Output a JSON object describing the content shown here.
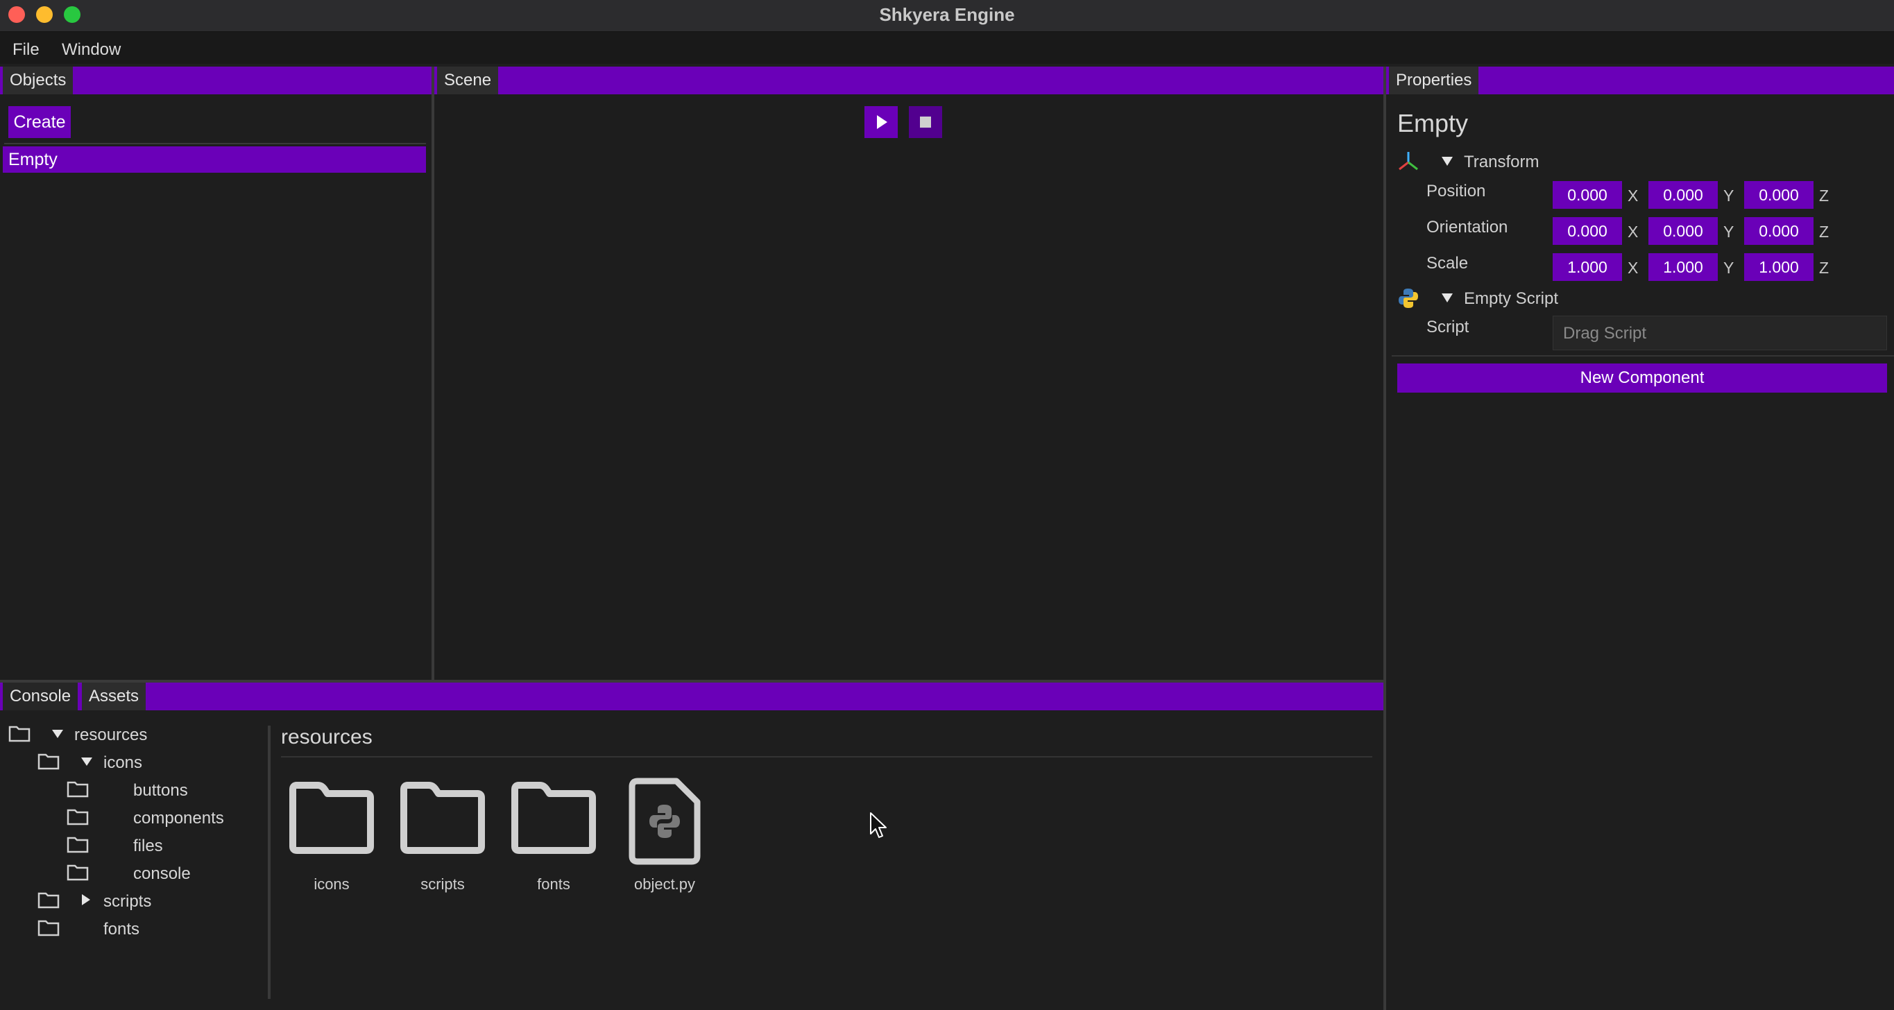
{
  "window": {
    "title": "Shkyera Engine"
  },
  "menubar": {
    "items": [
      "File",
      "Window"
    ]
  },
  "objects_panel": {
    "tab": "Objects",
    "create_label": "Create",
    "items": [
      "Empty"
    ]
  },
  "scene_panel": {
    "tab": "Scene"
  },
  "properties_panel": {
    "tab": "Properties",
    "object_name": "Empty",
    "transform": {
      "header": "Transform",
      "rows": [
        {
          "label": "Position",
          "values": [
            "0.000",
            "0.000",
            "0.000"
          ]
        },
        {
          "label": "Orientation",
          "values": [
            "0.000",
            "0.000",
            "0.000"
          ]
        },
        {
          "label": "Scale",
          "values": [
            "1.000",
            "1.000",
            "1.000"
          ]
        }
      ],
      "axes": [
        "X",
        "Y",
        "Z"
      ]
    },
    "script_component": {
      "header": "Empty Script",
      "script_label": "Script",
      "script_placeholder": "Drag Script"
    },
    "new_component_label": "New Component"
  },
  "bottom_panel": {
    "tabs": [
      "Console",
      "Assets"
    ],
    "tree": [
      {
        "name": "resources",
        "expand": "expanded"
      },
      {
        "name": "icons",
        "expand": "expanded"
      },
      {
        "name": "buttons",
        "expand": "none"
      },
      {
        "name": "components",
        "expand": "none"
      },
      {
        "name": "files",
        "expand": "none"
      },
      {
        "name": "console",
        "expand": "none"
      },
      {
        "name": "scripts",
        "expand": "collapsed"
      },
      {
        "name": "fonts",
        "expand": "none"
      }
    ],
    "current_path": "resources",
    "assets": [
      {
        "name": "icons",
        "type": "folder"
      },
      {
        "name": "scripts",
        "type": "folder"
      },
      {
        "name": "fonts",
        "type": "folder"
      },
      {
        "name": "object.py",
        "type": "python-file"
      }
    ]
  },
  "colors": {
    "accent": "#6a00b8",
    "background": "#1e1e1e",
    "titlebar": "#2c2c2e",
    "close": "#ff5f57",
    "minimize": "#febc2e",
    "maximize": "#28c840"
  }
}
